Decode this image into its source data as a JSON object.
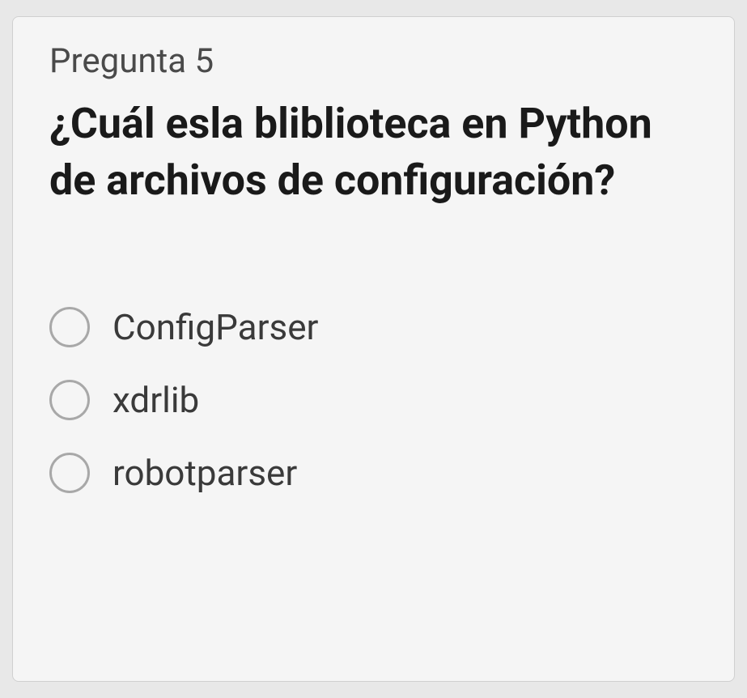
{
  "question": {
    "number_label": "Pregunta 5",
    "text": "¿Cuál esla bliblioteca en Python de archivos de configuración?"
  },
  "options": [
    {
      "label": "ConfigParser"
    },
    {
      "label": "xdrlib"
    },
    {
      "label": "robotparser"
    }
  ]
}
